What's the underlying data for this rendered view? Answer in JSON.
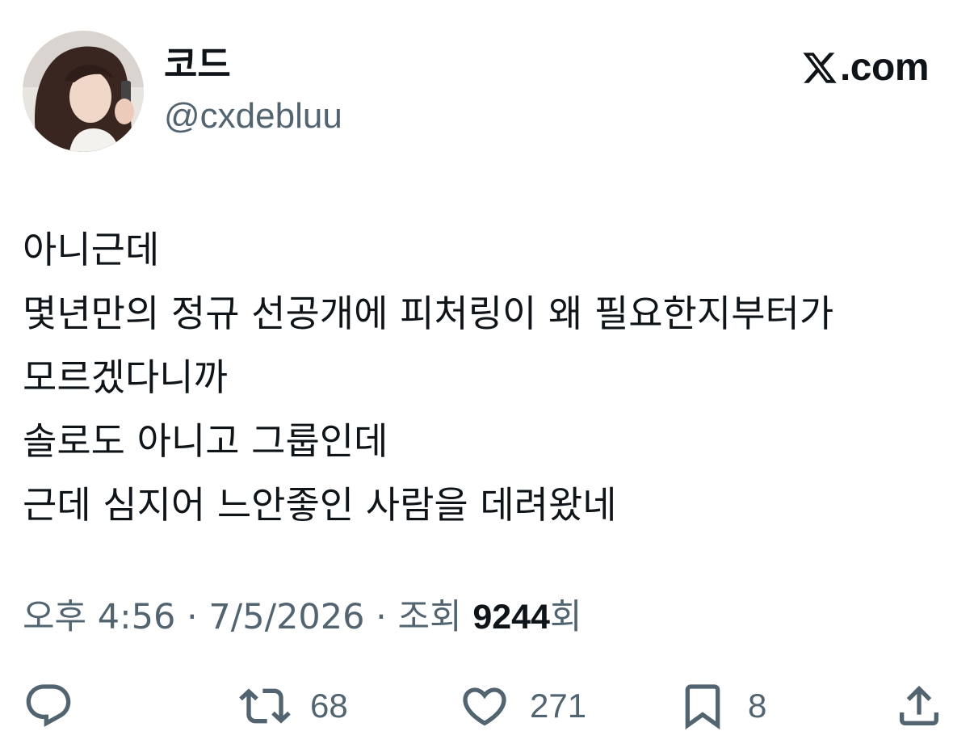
{
  "author": {
    "display_name": "코드",
    "handle": "@cxdebluu"
  },
  "brand": {
    "logo_icon": "x-logo-icon",
    "domain": ".com"
  },
  "tweet": {
    "lines": [
      "아니근데",
      "몇년만의 정규 선공개에 피처링이 왜 필요한지부터가",
      "모르겠다니까",
      "솔로도 아니고 그룹인데",
      "근데 심지어 느안좋인 사람을 데려왔네"
    ]
  },
  "meta": {
    "time": "오후 4:56",
    "separator": "·",
    "date": "7/5/2026",
    "views_label": "조회",
    "views_count": "9244",
    "views_suffix": "회"
  },
  "actions": {
    "reply": {
      "icon": "reply-icon"
    },
    "retweet": {
      "icon": "retweet-icon",
      "count": "68"
    },
    "like": {
      "icon": "heart-icon",
      "count": "271"
    },
    "bookmark": {
      "icon": "bookmark-icon",
      "count": "8"
    },
    "share": {
      "icon": "share-icon"
    }
  },
  "colors": {
    "text_primary": "#0f1419",
    "text_secondary": "#536471",
    "background": "#ffffff"
  }
}
